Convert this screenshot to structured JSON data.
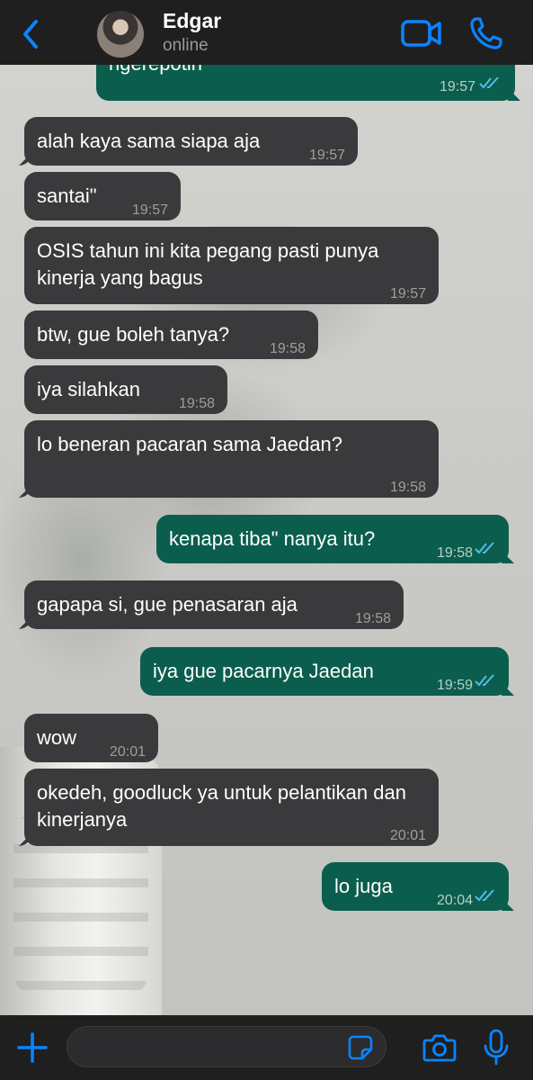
{
  "header": {
    "contact_name": "Edgar",
    "contact_status": "online",
    "accent_color": "#0a84ff"
  },
  "messages": [
    {
      "dir": "out",
      "text": "ngerepotin",
      "time": "19:57",
      "read": true
    },
    {
      "dir": "in",
      "text": "alah kaya sama siapa aja",
      "time": "19:57"
    },
    {
      "dir": "in",
      "text": "santai\"",
      "time": "19:57"
    },
    {
      "dir": "in",
      "text": "OSIS tahun ini kita pegang pasti punya kinerja yang bagus",
      "time": "19:57"
    },
    {
      "dir": "in",
      "text": "btw, gue boleh tanya?",
      "time": "19:58"
    },
    {
      "dir": "in",
      "text": "iya silahkan",
      "time": "19:58"
    },
    {
      "dir": "in",
      "text": "lo beneran pacaran sama Jaedan?",
      "time": "19:58"
    },
    {
      "dir": "out",
      "text": "kenapa tiba\" nanya itu?",
      "time": "19:58",
      "read": true
    },
    {
      "dir": "in",
      "text": "gapapa si, gue penasaran aja",
      "time": "19:58"
    },
    {
      "dir": "out",
      "text": "iya gue pacarnya Jaedan",
      "time": "19:59",
      "read": true
    },
    {
      "dir": "in",
      "text": "wow",
      "time": "20:01"
    },
    {
      "dir": "in",
      "text": "okedeh, goodluck ya untuk pelantikan dan kinerjanya",
      "time": "20:01"
    },
    {
      "dir": "out",
      "text": "lo juga",
      "time": "20:04",
      "read": true
    }
  ],
  "composer": {
    "input_value": "",
    "placeholder": ""
  },
  "icons": {
    "back": "chevron-left-icon",
    "video": "video-camera-icon",
    "call": "phone-icon",
    "plus": "plus-icon",
    "sticker": "sticker-icon",
    "camera": "camera-icon",
    "mic": "microphone-icon"
  },
  "colors": {
    "incoming_bubble": "#3a3a3c",
    "outgoing_bubble": "#0b5e4d",
    "read_ticks": "#53bdeb",
    "bar_background": "#1f1f1f"
  }
}
